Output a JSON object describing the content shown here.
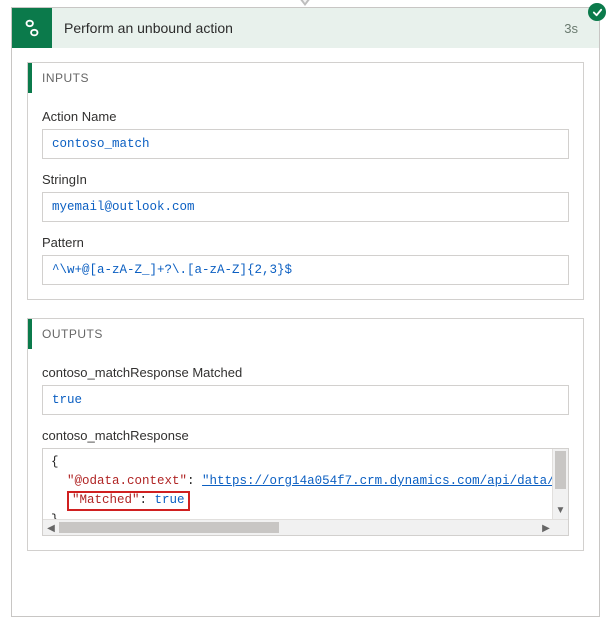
{
  "header": {
    "title": "Perform an unbound action",
    "duration": "3s"
  },
  "inputs": {
    "heading": "INPUTS",
    "fields": [
      {
        "label": "Action Name",
        "value": "contoso_match"
      },
      {
        "label": "StringIn",
        "value": "myemail@outlook.com"
      },
      {
        "label": "Pattern",
        "value": "^\\w+@[a-zA-Z_]+?\\.[a-zA-Z]{2,3}$"
      }
    ]
  },
  "outputs": {
    "heading": "OUTPUTS",
    "matched": {
      "label": "contoso_matchResponse Matched",
      "value": "true"
    },
    "response_label": "contoso_matchResponse",
    "json": {
      "brace_open": "{",
      "brace_close": "}",
      "odata_key": "\"@odata.context\"",
      "odata_url": "\"https://org14a054f7.crm.dynamics.com/api/data/",
      "matched_key": "\"Matched\"",
      "matched_val": "true",
      "colon": ": ",
      "comma": ","
    }
  }
}
